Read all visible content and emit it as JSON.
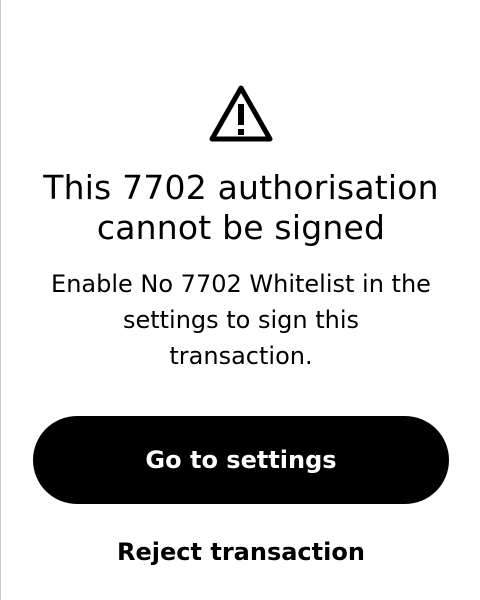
{
  "dialog": {
    "icon": "warning-triangle-icon",
    "title_lines": [
      "This 7702 authorisation",
      "cannot be signed"
    ],
    "description_lines": [
      "Enable No 7702 Whitelist in the",
      "settings to sign this",
      "transaction."
    ],
    "primary_button_label": "Go to settings",
    "secondary_button_label": "Reject transaction"
  },
  "colors": {
    "background": "#ffffff",
    "text": "#000000",
    "primary_button_bg": "#000000",
    "primary_button_text": "#ffffff"
  }
}
